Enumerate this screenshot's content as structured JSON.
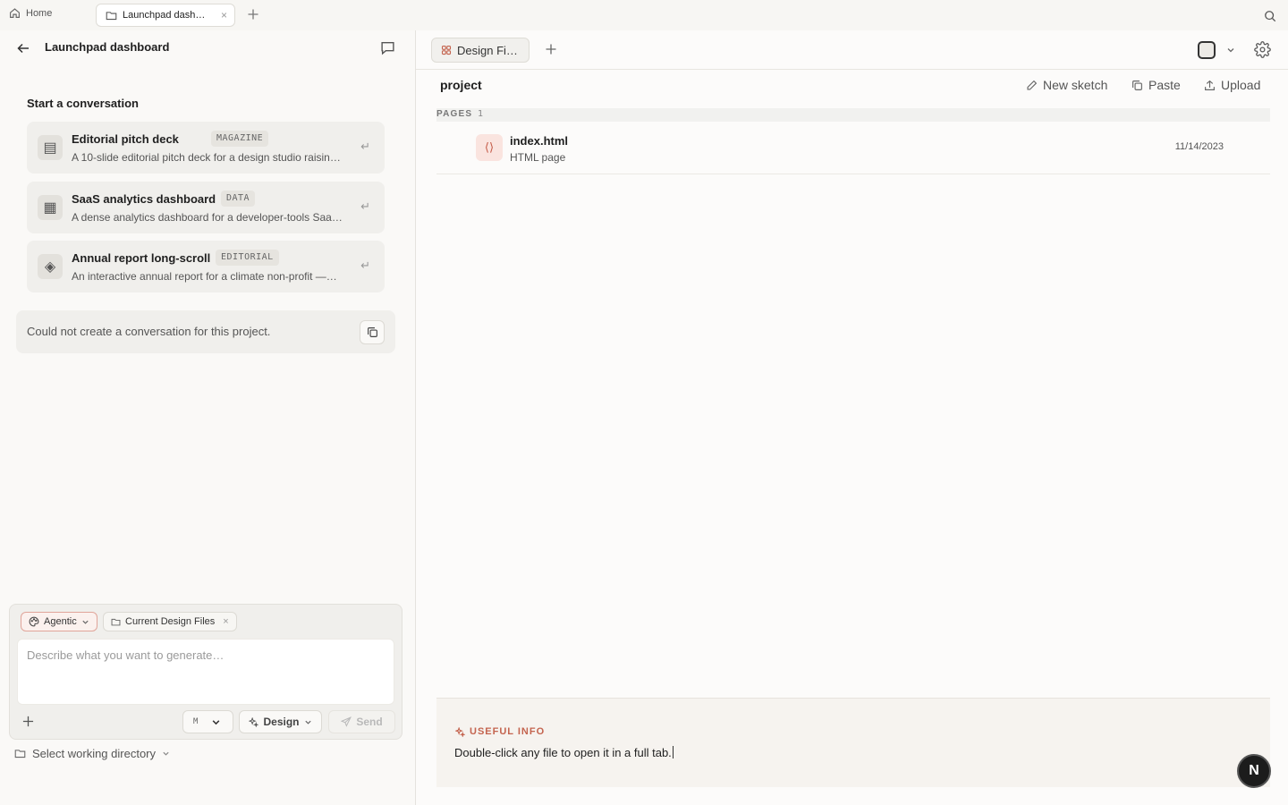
{
  "topbar": {
    "home_label": "Home",
    "active_tab_label": "Launchpad dash…",
    "close_glyph": "×"
  },
  "left": {
    "title": "Launchpad dashboard",
    "start_label": "Start a conversation",
    "templates": [
      {
        "title": "Editorial pitch deck",
        "badge": "MAGAZINE",
        "desc": "A 10-slide editorial pitch deck for a design studio raisin…",
        "icon": "▤",
        "enter": "↵"
      },
      {
        "title": "SaaS analytics dashboard",
        "badge": "DATA",
        "desc": "A dense analytics dashboard for a developer-tools Saa…",
        "icon": "▦",
        "enter": "↵"
      },
      {
        "title": "Annual report long-scroll",
        "badge": "EDITORIAL",
        "desc": "An interactive annual report for a climate non-profit —…",
        "icon": "◈",
        "enter": "↵"
      }
    ],
    "error_text": "Could not create a conversation for this project."
  },
  "composer": {
    "mode_chip": "Agentic",
    "context_chip": "Current Design Files",
    "context_close": "×",
    "placeholder": "Describe what you want to generate…",
    "model_badge": "M",
    "design_label": "Design",
    "send_label": "Send",
    "workdir_label": "Select working directory"
  },
  "right": {
    "tab_label": "Design Fi…",
    "folder_name": "project",
    "actions": {
      "new_sketch": "New sketch",
      "paste": "Paste",
      "upload": "Upload"
    },
    "pages_label": "PAGES",
    "pages_count": "1",
    "files": [
      {
        "name": "index.html",
        "type": "HTML page",
        "date": "11/14/2023",
        "icon": "⟨⟩"
      }
    ],
    "info_heading": "USEFUL INFO",
    "info_text": "Double-click any file to open it in a full tab."
  },
  "avatar_letter": "N",
  "colors": {
    "accent": "#c4644f",
    "background": "#faf9f7",
    "card": "#f0efec"
  }
}
